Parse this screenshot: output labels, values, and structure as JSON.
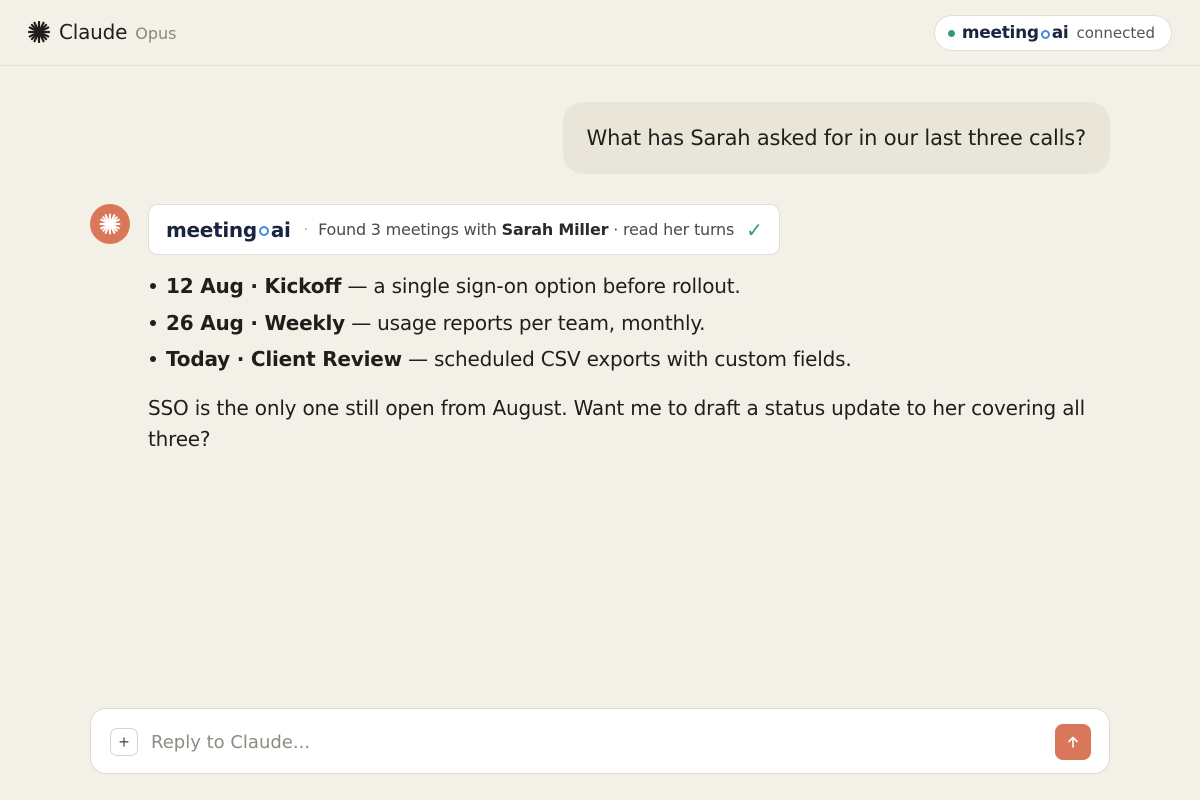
{
  "header": {
    "app_name": "Claude",
    "model": "Opus",
    "integration": {
      "logo_left": "meeting",
      "logo_right": "ai",
      "status": "connected",
      "status_color": "#2e9e6b"
    }
  },
  "conversation": {
    "user_message": "What has Sarah asked for in our last three calls?",
    "tool_call": {
      "logo_left": "meeting",
      "logo_right": "ai",
      "text_before": "Found 3 meetings with",
      "person": "Sarah Miller",
      "text_after": "· read her turns",
      "status_icon": "check-icon"
    },
    "answer": {
      "items": [
        {
          "label": "12 Aug · Kickoff",
          "text": "— a single sign-on option before rollout."
        },
        {
          "label": "26 Aug · Weekly",
          "text": "— usage reports per team, monthly."
        },
        {
          "label": "Today · Client Review",
          "text": "— scheduled CSV exports with custom fields."
        }
      ],
      "paragraph": "SSO is the only one still open from August. Want me to draft a status update to her covering all three?"
    }
  },
  "composer": {
    "add_label": "+",
    "placeholder": "Reply to Claude...",
    "send_icon": "arrow-up-icon"
  },
  "colors": {
    "background": "#f3f0e7",
    "accent": "#d9775a",
    "logo_blue": "#4a86e8",
    "logo_navy": "#1a2340"
  }
}
